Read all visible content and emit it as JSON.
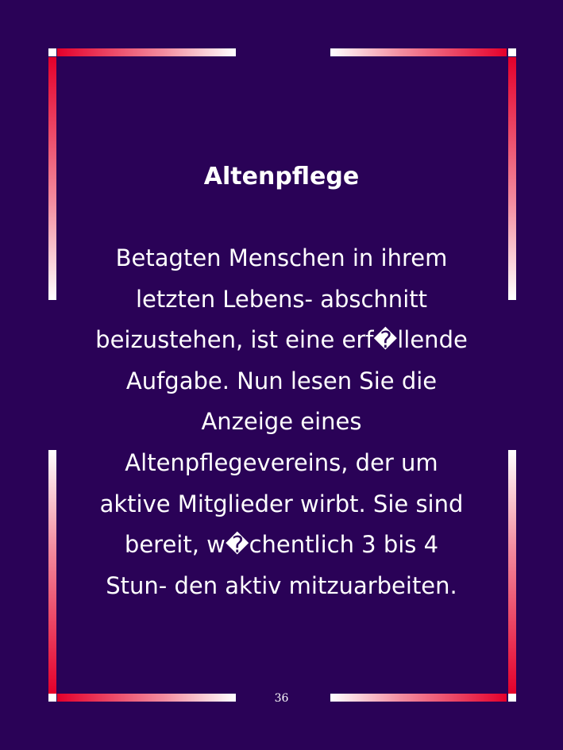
{
  "document": {
    "title": "Altenpflege",
    "body": " Betagten Menschen in ihrem\nletzten Lebens- abschnitt\nbeizustehen, ist eine erf�llende\nAufgabe. Nun lesen Sie die\nAnzeige eines\nAltenpflegevereins, der um\naktive Mitglieder wirbt. Sie sind\nbereit, w�chentlich 3 bis 4\nStun- den aktiv mitzuarbeiten.",
    "page_number": "36"
  },
  "colors": {
    "background": "#2a0257",
    "frame_accent": "#e4002b",
    "frame_light": "#ffffff",
    "text": "#ffffff"
  }
}
